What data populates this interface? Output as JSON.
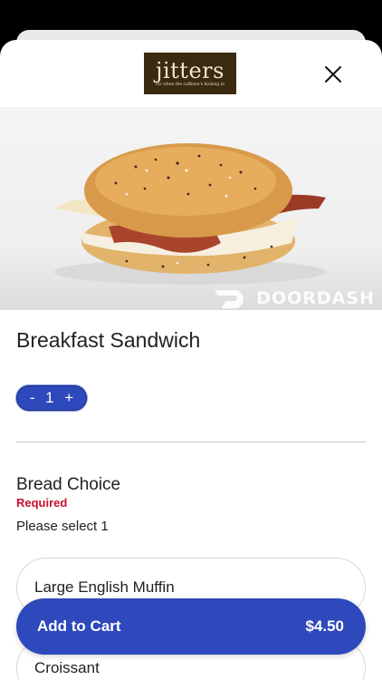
{
  "logo": {
    "text": "jitters",
    "tagline": "for when the caffeine's kicking in"
  },
  "hero": {
    "watermark": "DOORDASH"
  },
  "item": {
    "title": "Breakfast Sandwich"
  },
  "quantity": {
    "minus": "-",
    "value": "1",
    "plus": "+"
  },
  "section": {
    "title": "Bread Choice",
    "required": "Required",
    "note": "Please select 1",
    "options": [
      "Large English Muffin",
      "Croissant"
    ]
  },
  "cart": {
    "label": "Add to Cart",
    "price": "$4.50"
  },
  "colors": {
    "accent": "#2d49bb",
    "required": "#c8102e",
    "logo_bg": "#3b2a12"
  }
}
